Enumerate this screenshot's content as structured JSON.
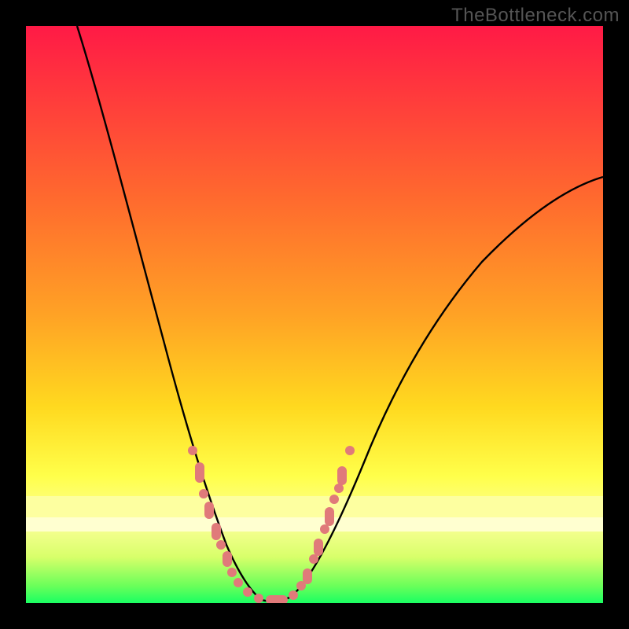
{
  "watermark": "TheBottleneck.com",
  "chart_data": {
    "type": "line",
    "title": "",
    "xlabel": "",
    "ylabel": "",
    "xlim": [
      0,
      100
    ],
    "ylim": [
      0,
      100
    ],
    "series": [
      {
        "name": "bottleneck-curve",
        "x": [
          9,
          15,
          20,
          24,
          28,
          32,
          35,
          38,
          41,
          43,
          46,
          50,
          55,
          60,
          67,
          75,
          83,
          90,
          100
        ],
        "y": [
          100,
          80,
          62,
          45,
          32,
          20,
          10,
          4,
          0.5,
          0.5,
          3,
          10,
          22,
          34,
          47,
          58,
          66,
          71,
          74
        ]
      }
    ],
    "markers_left": [
      {
        "x": 29,
        "y": 26
      },
      {
        "x": 30,
        "y": 22
      },
      {
        "x": 31,
        "y": 19
      },
      {
        "x": 32,
        "y": 15
      },
      {
        "x": 33,
        "y": 12
      },
      {
        "x": 34,
        "y": 10
      },
      {
        "x": 35,
        "y": 7
      },
      {
        "x": 36,
        "y": 5
      },
      {
        "x": 37,
        "y": 3.5
      }
    ],
    "markers_bottom": [
      {
        "x": 38.5,
        "y": 2
      },
      {
        "x": 40.5,
        "y": 0.8
      },
      {
        "x": 43,
        "y": 0.7
      },
      {
        "x": 46,
        "y": 1.3
      }
    ],
    "markers_right": [
      {
        "x": 47.5,
        "y": 3
      },
      {
        "x": 49,
        "y": 5
      },
      {
        "x": 50,
        "y": 7.5
      },
      {
        "x": 51,
        "y": 10
      },
      {
        "x": 52,
        "y": 13
      },
      {
        "x": 53,
        "y": 15
      },
      {
        "x": 53.5,
        "y": 18
      },
      {
        "x": 54,
        "y": 20
      },
      {
        "x": 55,
        "y": 23
      },
      {
        "x": 56,
        "y": 26.5
      }
    ],
    "gradient_stops": [
      {
        "pos": 0,
        "color": "#ff1a46"
      },
      {
        "pos": 12,
        "color": "#ff3a3c"
      },
      {
        "pos": 30,
        "color": "#ff6a2e"
      },
      {
        "pos": 50,
        "color": "#ffa225"
      },
      {
        "pos": 66,
        "color": "#ffd91f"
      },
      {
        "pos": 78,
        "color": "#ffff4a"
      },
      {
        "pos": 86,
        "color": "#fdff9a"
      },
      {
        "pos": 92,
        "color": "#d8ff6a"
      },
      {
        "pos": 97,
        "color": "#6bff5a"
      },
      {
        "pos": 100,
        "color": "#1aff62"
      }
    ]
  }
}
